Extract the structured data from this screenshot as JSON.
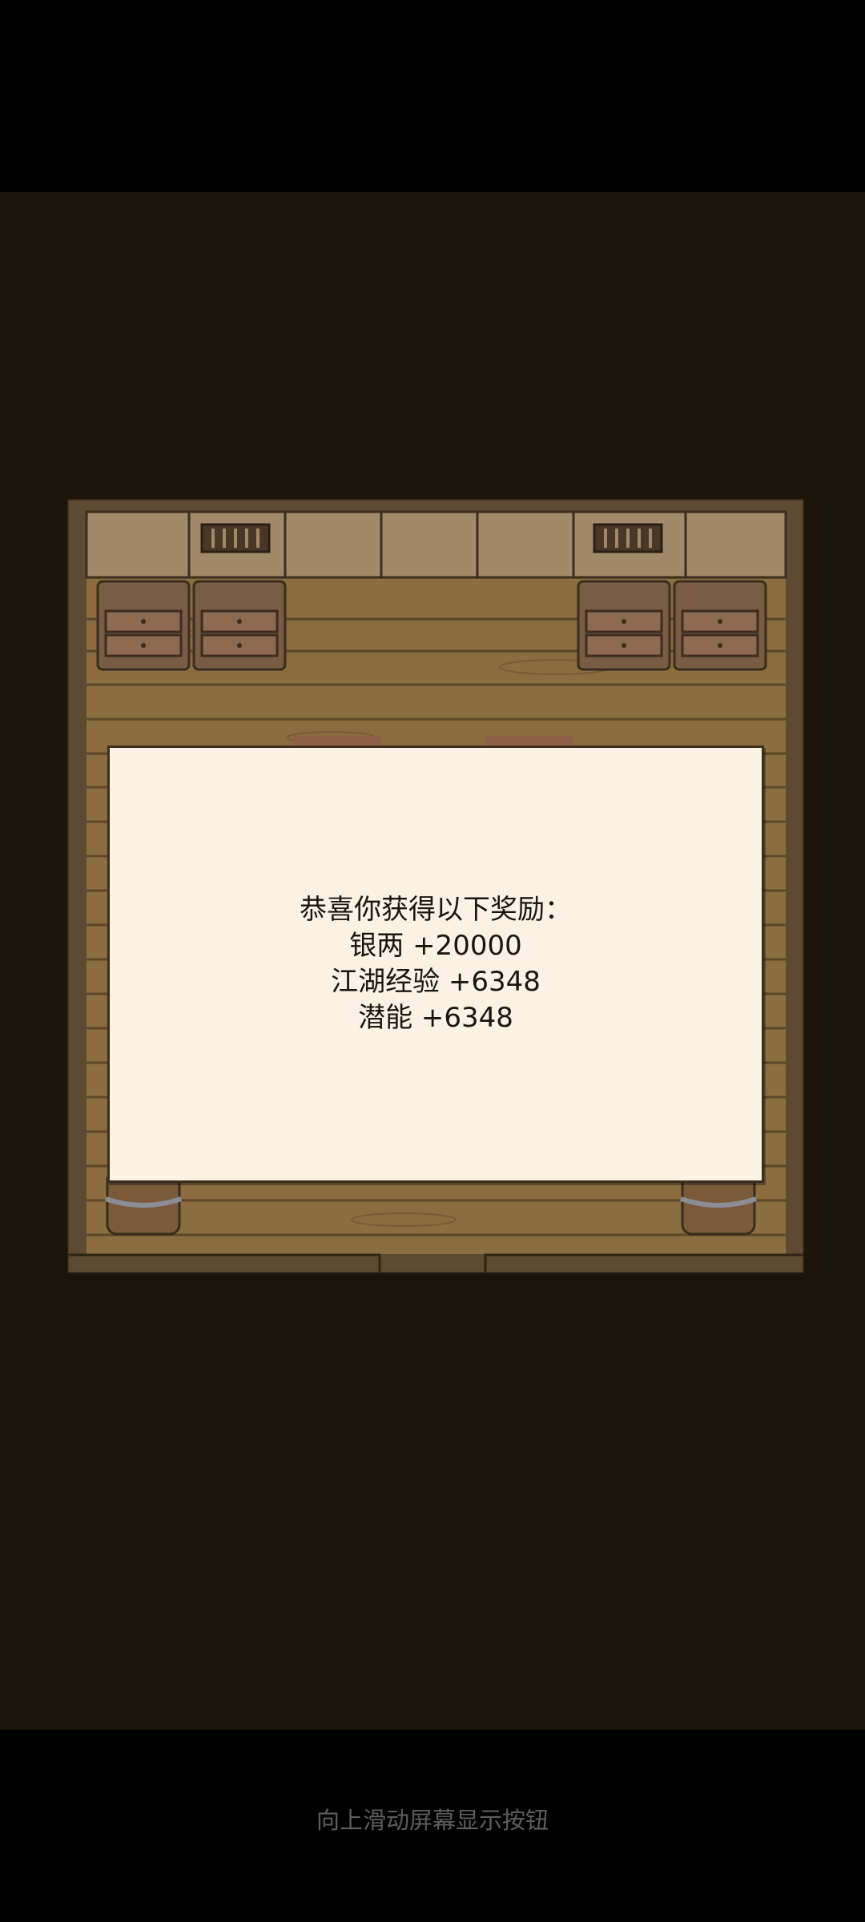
{
  "reward_dialog": {
    "lines": [
      "恭喜你获得以下奖励：",
      "银两 +20000",
      "江湖经验 +6348",
      "潜能 +6348"
    ]
  },
  "system_nav": {
    "hint": "向上滑动屏幕显示按钮"
  },
  "colors": {
    "background": "#1c1608",
    "floor": "#8a6b3e",
    "panel": "#faf2e3"
  }
}
